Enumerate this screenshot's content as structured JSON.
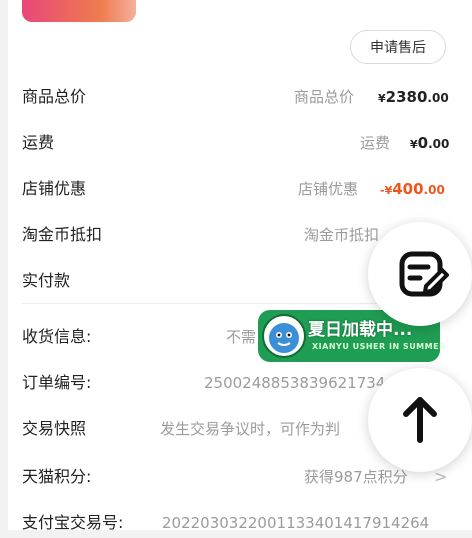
{
  "after_sale_label": "申请售后",
  "rows": {
    "total": {
      "label": "商品总价",
      "hint": "商品总价",
      "currency": "¥",
      "amount_int": "2380",
      "amount_dec": ".00"
    },
    "shipping": {
      "label": "运费",
      "hint": "运费",
      "currency": "¥",
      "amount_int": "0",
      "amount_dec": ".00"
    },
    "store_discount": {
      "label": "店铺优惠",
      "hint": "店铺优惠",
      "currency": "-¥",
      "amount_int": "400",
      "amount_dec": ".00"
    },
    "coin_deduct": {
      "label": "淘金币抵扣",
      "hint": "淘金币抵扣"
    },
    "paid": {
      "label": "实付款"
    },
    "shipping_info": {
      "label": "收货信息:",
      "hint": "不需"
    },
    "order_no": {
      "label": "订单编号:",
      "value": "2500248853839621734"
    },
    "snapshot": {
      "label": "交易快照",
      "hint": "发生交易争议时，可作为判"
    },
    "tmall_points": {
      "label": "天猫积分:",
      "hint": "获得987点积分",
      "chevron": ">"
    },
    "alipay_no": {
      "label": "支付宝交易号:",
      "value": "2022030322001133401417914264"
    }
  },
  "banner": {
    "title": "夏日加载中...",
    "subtitle": "XIANYU USHER IN SUMMER"
  },
  "fabs": {
    "edit_icon": "edit-note-icon",
    "up_icon": "arrow-up-icon"
  },
  "colors": {
    "discount": "#f0561b",
    "banner": "#1f9d53"
  }
}
